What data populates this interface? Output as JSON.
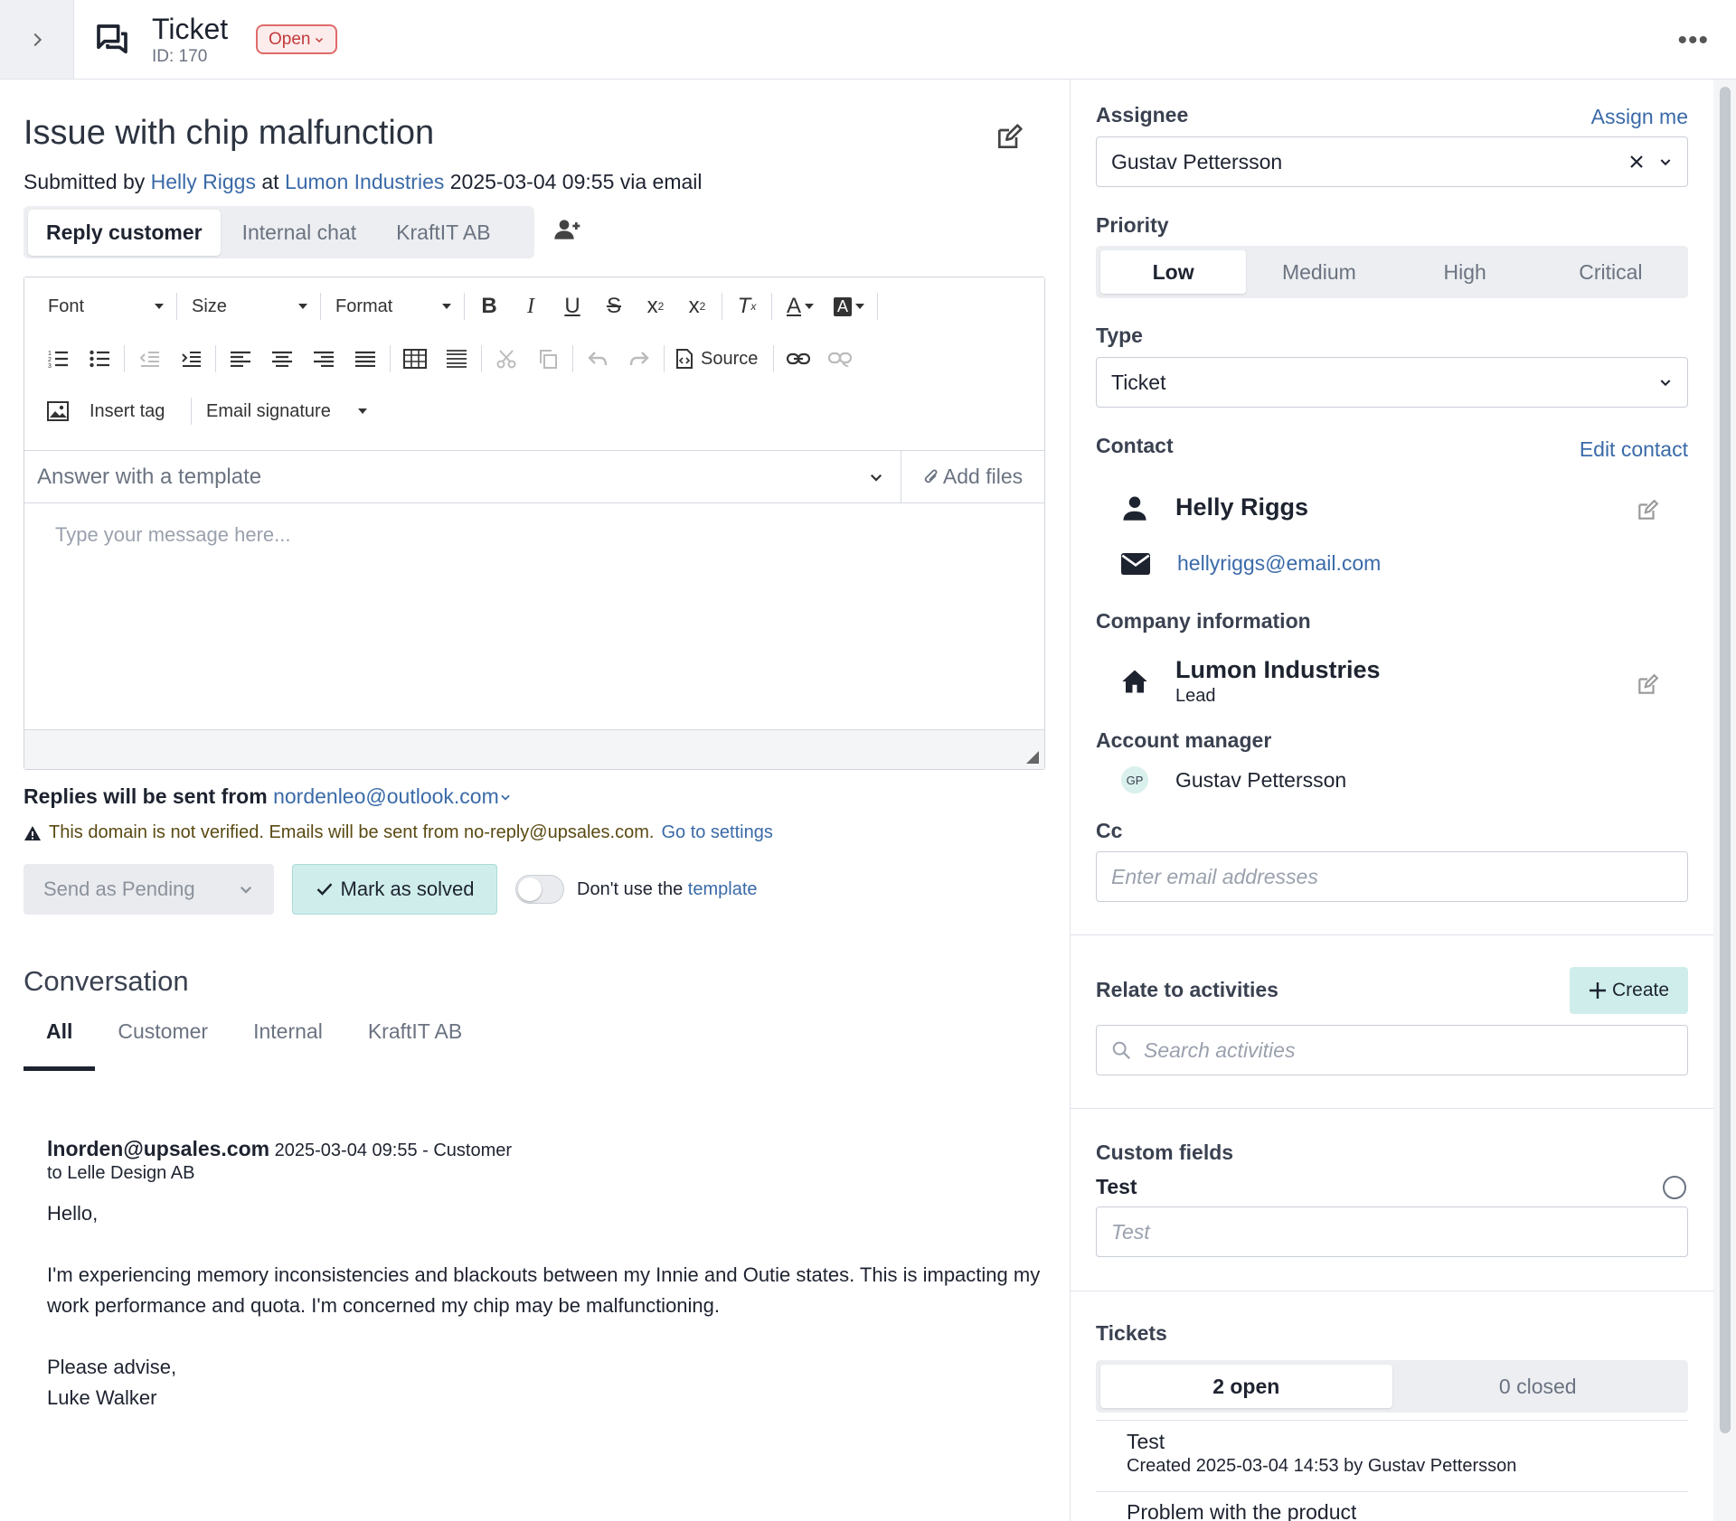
{
  "header": {
    "title": "Ticket",
    "id_text": "ID: 170",
    "status": "Open"
  },
  "ticket": {
    "subject": "Issue with chip malfunction",
    "submitted_prefix": "Submitted by",
    "submitter": "Helly Riggs",
    "at_text": "at",
    "company": "Lumon Industries",
    "submitted_suffix": "2025-03-04 09:55 via email"
  },
  "reply_tabs": [
    "Reply customer",
    "Internal chat",
    "KraftIT AB"
  ],
  "toolbar": {
    "font": "Font",
    "size": "Size",
    "format": "Format",
    "source": "Source",
    "insert_tag": "Insert tag",
    "email_signature": "Email signature"
  },
  "template_placeholder": "Answer with a template",
  "add_files": "Add files",
  "message_placeholder": "Type your message here...",
  "replies": {
    "label": "Replies will be sent from",
    "email": "nordenleo@outlook.com"
  },
  "warning": {
    "text": "This domain is not verified. Emails will be sent from no-reply@upsales.com.",
    "link": "Go to settings"
  },
  "actions": {
    "send_pending": "Send as Pending",
    "mark_solved": "Mark as solved",
    "toggle_prefix": "Don't use the",
    "toggle_link": "template"
  },
  "conversation": {
    "title": "Conversation",
    "tabs": [
      "All",
      "Customer",
      "Internal",
      "KraftIT AB"
    ],
    "message": {
      "from": "lnorden@upsales.com",
      "meta": "2025-03-04 09:55 - Customer",
      "to": "to Lelle Design AB",
      "body": "Hello,\n\nI'm experiencing memory inconsistencies and blackouts between my Innie and Outie states. This is impacting my work performance and quota. I'm concerned my chip may be malfunctioning.\n\nPlease advise,\nLuke Walker"
    }
  },
  "sidebar": {
    "assignee_label": "Assignee",
    "assign_me": "Assign me",
    "assignee": "Gustav Pettersson",
    "priority_label": "Priority",
    "priorities": [
      "Low",
      "Medium",
      "High",
      "Critical"
    ],
    "type_label": "Type",
    "type": "Ticket",
    "contact_label": "Contact",
    "edit_contact": "Edit contact",
    "contact_name": "Helly Riggs",
    "contact_email": "hellyriggs@email.com",
    "company_label": "Company information",
    "company_name": "Lumon Industries",
    "company_status": "Lead",
    "account_manager_label": "Account manager",
    "account_manager_initials": "GP",
    "account_manager": "Gustav Pettersson",
    "cc_label": "Cc",
    "cc_placeholder": "Enter email addresses",
    "relate_label": "Relate to activities",
    "create": "Create",
    "search_placeholder": "Search activities",
    "custom_fields_label": "Custom fields",
    "custom_field_name": "Test",
    "custom_field_placeholder": "Test",
    "tickets_label": "Tickets",
    "tickets_open": "2 open",
    "tickets_closed": "0 closed",
    "ticket_items": [
      {
        "title": "Test",
        "meta": "Created 2025-03-04 14:53 by Gustav Pettersson"
      },
      {
        "title": "Problem with the product",
        "meta": ""
      }
    ]
  },
  "colors": {
    "accent_link": "#3a6aa8",
    "status_red": "#c23a3a",
    "teal_button": "#cfeeeb"
  }
}
